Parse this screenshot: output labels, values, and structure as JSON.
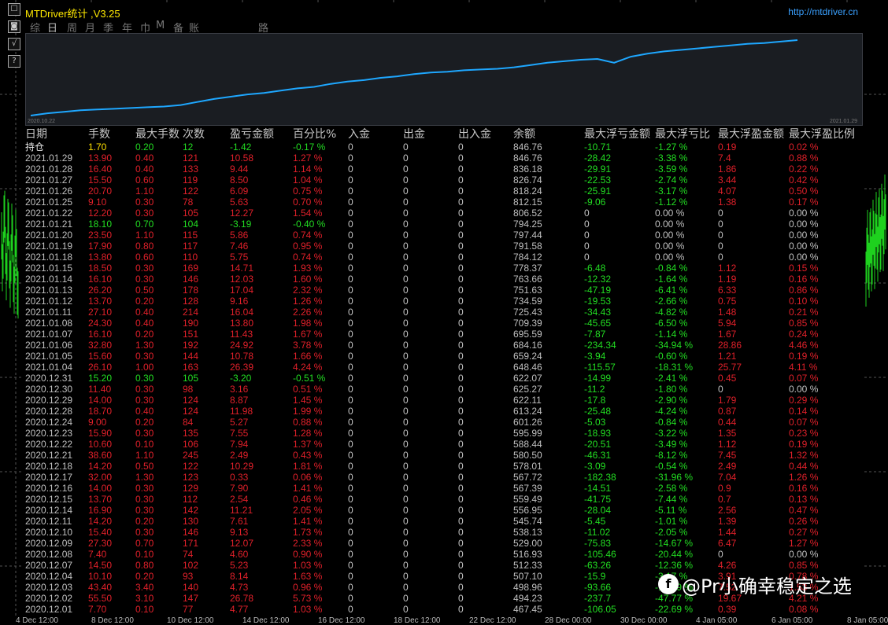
{
  "app": {
    "title": "MTDriver统计 ,V3.25",
    "url": "http://mtdriver.cn"
  },
  "tabs": [
    "综",
    "日",
    "周",
    "月",
    "季",
    "年",
    "巾",
    "M",
    "备",
    "账户",
    "路径"
  ],
  "active_tab": "日",
  "toolbar": [
    "minimize-icon",
    "settings-icon",
    "sqrt-icon",
    "help-icon"
  ],
  "toolbar_glyphs": [
    "☐",
    "◙",
    "√",
    "?"
  ],
  "equity": {
    "start_label": "2020.10.22",
    "end_label": "2021.01.29",
    "line_color": "#1ea7ff",
    "chart_data": {
      "type": "line",
      "x": [
        "2020.10.22",
        "2021.01.29"
      ],
      "ylim": [
        0,
        1
      ],
      "values": [
        0.0,
        0.03,
        0.05,
        0.07,
        0.08,
        0.09,
        0.1,
        0.11,
        0.12,
        0.14,
        0.18,
        0.22,
        0.25,
        0.28,
        0.3,
        0.33,
        0.36,
        0.38,
        0.42,
        0.45,
        0.47,
        0.5,
        0.52,
        0.55,
        0.57,
        0.58,
        0.6,
        0.61,
        0.62,
        0.64,
        0.67,
        0.7,
        0.72,
        0.74,
        0.75,
        0.7,
        0.78,
        0.82,
        0.85,
        0.87,
        0.89,
        0.91,
        0.93,
        0.95,
        0.96,
        0.98,
        1.0
      ]
    }
  },
  "table": {
    "headers": [
      "日期",
      "手数",
      "最大手数",
      "次数",
      "盈亏金额",
      "百分比%",
      "入金",
      "出金",
      "出入金",
      "余额",
      "最大浮亏金额",
      "最大浮亏比",
      "最大浮盈金额",
      "最大浮盈比例"
    ],
    "rows": [
      {
        "d": "持仓",
        "lots": "1.70",
        "max": "0.20",
        "n": "12",
        "pl": "-1.42",
        "pct": "-0.17 %",
        "in": "0",
        "out": "0",
        "net": "0",
        "bal": "846.76",
        "fl": "-10.71",
        "flp": "-1.27 %",
        "fp": "0.19",
        "fpp": "0.02 %",
        "s": "open"
      },
      {
        "d": "2021.01.29",
        "lots": "13.90",
        "max": "0.40",
        "n": "121",
        "pl": "10.58",
        "pct": "1.27 %",
        "in": "0",
        "out": "0",
        "net": "0",
        "bal": "846.76",
        "fl": "-28.42",
        "flp": "-3.38 %",
        "fp": "7.4",
        "fpp": "0.88 %",
        "s": "r"
      },
      {
        "d": "2021.01.28",
        "lots": "16.40",
        "max": "0.40",
        "n": "133",
        "pl": "9.44",
        "pct": "1.14 %",
        "in": "0",
        "out": "0",
        "net": "0",
        "bal": "836.18",
        "fl": "-29.91",
        "flp": "-3.59 %",
        "fp": "1.86",
        "fpp": "0.22 %",
        "s": "r"
      },
      {
        "d": "2021.01.27",
        "lots": "15.50",
        "max": "0.60",
        "n": "119",
        "pl": "8.50",
        "pct": "1.04 %",
        "in": "0",
        "out": "0",
        "net": "0",
        "bal": "826.74",
        "fl": "-22.53",
        "flp": "-2.74 %",
        "fp": "3.44",
        "fpp": "0.42 %",
        "s": "r"
      },
      {
        "d": "2021.01.26",
        "lots": "20.70",
        "max": "1.10",
        "n": "122",
        "pl": "6.09",
        "pct": "0.75 %",
        "in": "0",
        "out": "0",
        "net": "0",
        "bal": "818.24",
        "fl": "-25.91",
        "flp": "-3.17 %",
        "fp": "4.07",
        "fpp": "0.50 %",
        "s": "r"
      },
      {
        "d": "2021.01.25",
        "lots": "9.10",
        "max": "0.30",
        "n": "78",
        "pl": "5.63",
        "pct": "0.70 %",
        "in": "0",
        "out": "0",
        "net": "0",
        "bal": "812.15",
        "fl": "-9.06",
        "flp": "-1.12 %",
        "fp": "1.38",
        "fpp": "0.17 %",
        "s": "r"
      },
      {
        "d": "2021.01.22",
        "lots": "12.20",
        "max": "0.30",
        "n": "105",
        "pl": "12.27",
        "pct": "1.54 %",
        "in": "0",
        "out": "0",
        "net": "0",
        "bal": "806.52",
        "fl": "0",
        "flp": "0.00 %",
        "fp": "0",
        "fpp": "0.00 %",
        "s": "rz"
      },
      {
        "d": "2021.01.21",
        "lots": "18.10",
        "max": "0.70",
        "n": "104",
        "pl": "-3.19",
        "pct": "-0.40 %",
        "in": "0",
        "out": "0",
        "net": "0",
        "bal": "794.25",
        "fl": "0",
        "flp": "0.00 %",
        "fp": "0",
        "fpp": "0.00 %",
        "s": "gz"
      },
      {
        "d": "2021.01.20",
        "lots": "23.50",
        "max": "1.10",
        "n": "115",
        "pl": "5.86",
        "pct": "0.74 %",
        "in": "0",
        "out": "0",
        "net": "0",
        "bal": "797.44",
        "fl": "0",
        "flp": "0.00 %",
        "fp": "0",
        "fpp": "0.00 %",
        "s": "rz"
      },
      {
        "d": "2021.01.19",
        "lots": "17.90",
        "max": "0.80",
        "n": "117",
        "pl": "7.46",
        "pct": "0.95 %",
        "in": "0",
        "out": "0",
        "net": "0",
        "bal": "791.58",
        "fl": "0",
        "flp": "0.00 %",
        "fp": "0",
        "fpp": "0.00 %",
        "s": "rz"
      },
      {
        "d": "2021.01.18",
        "lots": "13.80",
        "max": "0.60",
        "n": "110",
        "pl": "5.75",
        "pct": "0.74 %",
        "in": "0",
        "out": "0",
        "net": "0",
        "bal": "784.12",
        "fl": "0",
        "flp": "0.00 %",
        "fp": "0",
        "fpp": "0.00 %",
        "s": "rz"
      },
      {
        "d": "2021.01.15",
        "lots": "18.50",
        "max": "0.30",
        "n": "169",
        "pl": "14.71",
        "pct": "1.93 %",
        "in": "0",
        "out": "0",
        "net": "0",
        "bal": "778.37",
        "fl": "-6.48",
        "flp": "-0.84 %",
        "fp": "1.12",
        "fpp": "0.15 %",
        "s": "r"
      },
      {
        "d": "2021.01.14",
        "lots": "16.10",
        "max": "0.30",
        "n": "146",
        "pl": "12.03",
        "pct": "1.60 %",
        "in": "0",
        "out": "0",
        "net": "0",
        "bal": "763.66",
        "fl": "-12.32",
        "flp": "-1.64 %",
        "fp": "1.19",
        "fpp": "0.16 %",
        "s": "r"
      },
      {
        "d": "2021.01.13",
        "lots": "26.20",
        "max": "0.50",
        "n": "178",
        "pl": "17.04",
        "pct": "2.32 %",
        "in": "0",
        "out": "0",
        "net": "0",
        "bal": "751.63",
        "fl": "-47.19",
        "flp": "-6.41 %",
        "fp": "6.33",
        "fpp": "0.86 %",
        "s": "r"
      },
      {
        "d": "2021.01.12",
        "lots": "13.70",
        "max": "0.20",
        "n": "128",
        "pl": "9.16",
        "pct": "1.26 %",
        "in": "0",
        "out": "0",
        "net": "0",
        "bal": "734.59",
        "fl": "-19.53",
        "flp": "-2.66 %",
        "fp": "0.75",
        "fpp": "0.10 %",
        "s": "r"
      },
      {
        "d": "2021.01.11",
        "lots": "27.10",
        "max": "0.40",
        "n": "214",
        "pl": "16.04",
        "pct": "2.26 %",
        "in": "0",
        "out": "0",
        "net": "0",
        "bal": "725.43",
        "fl": "-34.43",
        "flp": "-4.82 %",
        "fp": "1.48",
        "fpp": "0.21 %",
        "s": "r"
      },
      {
        "d": "2021.01.08",
        "lots": "24.30",
        "max": "0.40",
        "n": "190",
        "pl": "13.80",
        "pct": "1.98 %",
        "in": "0",
        "out": "0",
        "net": "0",
        "bal": "709.39",
        "fl": "-45.65",
        "flp": "-6.50 %",
        "fp": "5.94",
        "fpp": "0.85 %",
        "s": "r"
      },
      {
        "d": "2021.01.07",
        "lots": "16.10",
        "max": "0.20",
        "n": "151",
        "pl": "11.43",
        "pct": "1.67 %",
        "in": "0",
        "out": "0",
        "net": "0",
        "bal": "695.59",
        "fl": "-7.87",
        "flp": "-1.14 %",
        "fp": "1.67",
        "fpp": "0.24 %",
        "s": "r"
      },
      {
        "d": "2021.01.06",
        "lots": "32.80",
        "max": "1.30",
        "n": "192",
        "pl": "24.92",
        "pct": "3.78 %",
        "in": "0",
        "out": "0",
        "net": "0",
        "bal": "684.16",
        "fl": "-234.34",
        "flp": "-34.94 %",
        "fp": "28.86",
        "fpp": "4.46 %",
        "s": "r"
      },
      {
        "d": "2021.01.05",
        "lots": "15.60",
        "max": "0.30",
        "n": "144",
        "pl": "10.78",
        "pct": "1.66 %",
        "in": "0",
        "out": "0",
        "net": "0",
        "bal": "659.24",
        "fl": "-3.94",
        "flp": "-0.60 %",
        "fp": "1.21",
        "fpp": "0.19 %",
        "s": "r"
      },
      {
        "d": "2021.01.04",
        "lots": "26.10",
        "max": "1.00",
        "n": "163",
        "pl": "26.39",
        "pct": "4.24 %",
        "in": "0",
        "out": "0",
        "net": "0",
        "bal": "648.46",
        "fl": "-115.57",
        "flp": "-18.31 %",
        "fp": "25.77",
        "fpp": "4.11 %",
        "s": "r"
      },
      {
        "d": "2020.12.31",
        "lots": "15.20",
        "max": "0.30",
        "n": "105",
        "pl": "-3.20",
        "pct": "-0.51 %",
        "in": "0",
        "out": "0",
        "net": "0",
        "bal": "622.07",
        "fl": "-14.99",
        "flp": "-2.41 %",
        "fp": "0.45",
        "fpp": "0.07 %",
        "s": "g"
      },
      {
        "d": "2020.12.30",
        "lots": "11.40",
        "max": "0.30",
        "n": "98",
        "pl": "3.16",
        "pct": "0.51 %",
        "in": "0",
        "out": "0",
        "net": "0",
        "bal": "625.27",
        "fl": "-11.2",
        "flp": "-1.80 %",
        "fp": "0",
        "fpp": "0.00 %",
        "s": "rz2"
      },
      {
        "d": "2020.12.29",
        "lots": "14.00",
        "max": "0.30",
        "n": "124",
        "pl": "8.87",
        "pct": "1.45 %",
        "in": "0",
        "out": "0",
        "net": "0",
        "bal": "622.11",
        "fl": "-17.8",
        "flp": "-2.90 %",
        "fp": "1.79",
        "fpp": "0.29 %",
        "s": "r"
      },
      {
        "d": "2020.12.28",
        "lots": "18.70",
        "max": "0.40",
        "n": "124",
        "pl": "11.98",
        "pct": "1.99 %",
        "in": "0",
        "out": "0",
        "net": "0",
        "bal": "613.24",
        "fl": "-25.48",
        "flp": "-4.24 %",
        "fp": "0.87",
        "fpp": "0.14 %",
        "s": "r"
      },
      {
        "d": "2020.12.24",
        "lots": "9.00",
        "max": "0.20",
        "n": "84",
        "pl": "5.27",
        "pct": "0.88 %",
        "in": "0",
        "out": "0",
        "net": "0",
        "bal": "601.26",
        "fl": "-5.03",
        "flp": "-0.84 %",
        "fp": "0.44",
        "fpp": "0.07 %",
        "s": "r"
      },
      {
        "d": "2020.12.23",
        "lots": "15.90",
        "max": "0.30",
        "n": "135",
        "pl": "7.55",
        "pct": "1.28 %",
        "in": "0",
        "out": "0",
        "net": "0",
        "bal": "595.99",
        "fl": "-18.93",
        "flp": "-3.22 %",
        "fp": "1.35",
        "fpp": "0.23 %",
        "s": "r"
      },
      {
        "d": "2020.12.22",
        "lots": "10.60",
        "max": "0.10",
        "n": "106",
        "pl": "7.94",
        "pct": "1.37 %",
        "in": "0",
        "out": "0",
        "net": "0",
        "bal": "588.44",
        "fl": "-20.51",
        "flp": "-3.49 %",
        "fp": "1.12",
        "fpp": "0.19 %",
        "s": "r"
      },
      {
        "d": "2020.12.21",
        "lots": "38.60",
        "max": "1.10",
        "n": "245",
        "pl": "2.49",
        "pct": "0.43 %",
        "in": "0",
        "out": "0",
        "net": "0",
        "bal": "580.50",
        "fl": "-46.31",
        "flp": "-8.12 %",
        "fp": "7.45",
        "fpp": "1.32 %",
        "s": "r"
      },
      {
        "d": "2020.12.18",
        "lots": "14.20",
        "max": "0.50",
        "n": "122",
        "pl": "10.29",
        "pct": "1.81 %",
        "in": "0",
        "out": "0",
        "net": "0",
        "bal": "578.01",
        "fl": "-3.09",
        "flp": "-0.54 %",
        "fp": "2.49",
        "fpp": "0.44 %",
        "s": "r"
      },
      {
        "d": "2020.12.17",
        "lots": "32.00",
        "max": "1.30",
        "n": "123",
        "pl": "0.33",
        "pct": "0.06 %",
        "in": "0",
        "out": "0",
        "net": "0",
        "bal": "567.72",
        "fl": "-182.38",
        "flp": "-31.96 %",
        "fp": "7.04",
        "fpp": "1.26 %",
        "s": "r"
      },
      {
        "d": "2020.12.16",
        "lots": "14.00",
        "max": "0.30",
        "n": "129",
        "pl": "7.90",
        "pct": "1.41 %",
        "in": "0",
        "out": "0",
        "net": "0",
        "bal": "567.39",
        "fl": "-14.51",
        "flp": "-2.58 %",
        "fp": "0.9",
        "fpp": "0.16 %",
        "s": "r"
      },
      {
        "d": "2020.12.15",
        "lots": "13.70",
        "max": "0.30",
        "n": "112",
        "pl": "2.54",
        "pct": "0.46 %",
        "in": "0",
        "out": "0",
        "net": "0",
        "bal": "559.49",
        "fl": "-41.75",
        "flp": "-7.44 %",
        "fp": "0.7",
        "fpp": "0.13 %",
        "s": "r"
      },
      {
        "d": "2020.12.14",
        "lots": "16.90",
        "max": "0.30",
        "n": "142",
        "pl": "11.21",
        "pct": "2.05 %",
        "in": "0",
        "out": "0",
        "net": "0",
        "bal": "556.95",
        "fl": "-28.04",
        "flp": "-5.11 %",
        "fp": "2.56",
        "fpp": "0.47 %",
        "s": "r"
      },
      {
        "d": "2020.12.11",
        "lots": "14.20",
        "max": "0.20",
        "n": "130",
        "pl": "7.61",
        "pct": "1.41 %",
        "in": "0",
        "out": "0",
        "net": "0",
        "bal": "545.74",
        "fl": "-5.45",
        "flp": "-1.01 %",
        "fp": "1.39",
        "fpp": "0.26 %",
        "s": "r"
      },
      {
        "d": "2020.12.10",
        "lots": "15.40",
        "max": "0.30",
        "n": "146",
        "pl": "9.13",
        "pct": "1.73 %",
        "in": "0",
        "out": "0",
        "net": "0",
        "bal": "538.13",
        "fl": "-11.02",
        "flp": "-2.05 %",
        "fp": "1.44",
        "fpp": "0.27 %",
        "s": "r"
      },
      {
        "d": "2020.12.09",
        "lots": "27.30",
        "max": "0.70",
        "n": "171",
        "pl": "12.07",
        "pct": "2.33 %",
        "in": "0",
        "out": "0",
        "net": "0",
        "bal": "529.00",
        "fl": "-75.83",
        "flp": "-14.67 %",
        "fp": "6.47",
        "fpp": "1.27 %",
        "s": "r"
      },
      {
        "d": "2020.12.08",
        "lots": "7.40",
        "max": "0.10",
        "n": "74",
        "pl": "4.60",
        "pct": "0.90 %",
        "in": "0",
        "out": "0",
        "net": "0",
        "bal": "516.93",
        "fl": "-105.46",
        "flp": "-20.44 %",
        "fp": "0",
        "fpp": "0.00 %",
        "s": "rz2"
      },
      {
        "d": "2020.12.07",
        "lots": "14.50",
        "max": "0.80",
        "n": "102",
        "pl": "5.23",
        "pct": "1.03 %",
        "in": "0",
        "out": "0",
        "net": "0",
        "bal": "512.33",
        "fl": "-63.26",
        "flp": "-12.36 %",
        "fp": "4.26",
        "fpp": "0.85 %",
        "s": "r"
      },
      {
        "d": "2020.12.04",
        "lots": "10.10",
        "max": "0.20",
        "n": "93",
        "pl": "8.14",
        "pct": "1.63 %",
        "in": "0",
        "out": "0",
        "net": "0",
        "bal": "507.10",
        "fl": "-15.9",
        "flp": "-3.17 %",
        "fp": "3.91",
        "fpp": "0.78 %",
        "s": "r"
      },
      {
        "d": "2020.12.03",
        "lots": "43.40",
        "max": "3.40",
        "n": "140",
        "pl": "4.73",
        "pct": "0.96 %",
        "in": "0",
        "out": "0",
        "net": "0",
        "bal": "498.96",
        "fl": "-93.66",
        "flp": "-18.79 %",
        "fp": "7.52",
        "fpp": "1.53 %",
        "s": "r"
      },
      {
        "d": "2020.12.02",
        "lots": "55.50",
        "max": "3.10",
        "n": "147",
        "pl": "26.78",
        "pct": "5.73 %",
        "in": "0",
        "out": "0",
        "net": "0",
        "bal": "494.23",
        "fl": "-237.7",
        "flp": "-47.77 %",
        "fp": "19.67",
        "fpp": "4.21 %",
        "s": "r"
      },
      {
        "d": "2020.12.01",
        "lots": "7.70",
        "max": "0.10",
        "n": "77",
        "pl": "4.77",
        "pct": "1.03 %",
        "in": "0",
        "out": "0",
        "net": "0",
        "bal": "467.45",
        "fl": "-106.05",
        "flp": "-22.69 %",
        "fp": "0.39",
        "fpp": "0.08 %",
        "s": "r"
      }
    ]
  },
  "bottom_axis": [
    "4 Dec 12:00",
    "8 Dec 12:00",
    "10 Dec 12:00",
    "14 Dec 12:00",
    "16 Dec 12:00",
    "18 Dec 12:00",
    "22 Dec 12:00",
    "28 Dec 00:00",
    "30 Dec 00:00",
    "4 Jan 05:00",
    "6 Jan 05:00",
    "8 Jan 05:00"
  ],
  "watermark": "@Pr小确幸稳定之选",
  "colors": {
    "positive": "#e0202a",
    "negative": "#22dd22",
    "open": "#ffe000",
    "neutral": "#c0c0c0"
  }
}
